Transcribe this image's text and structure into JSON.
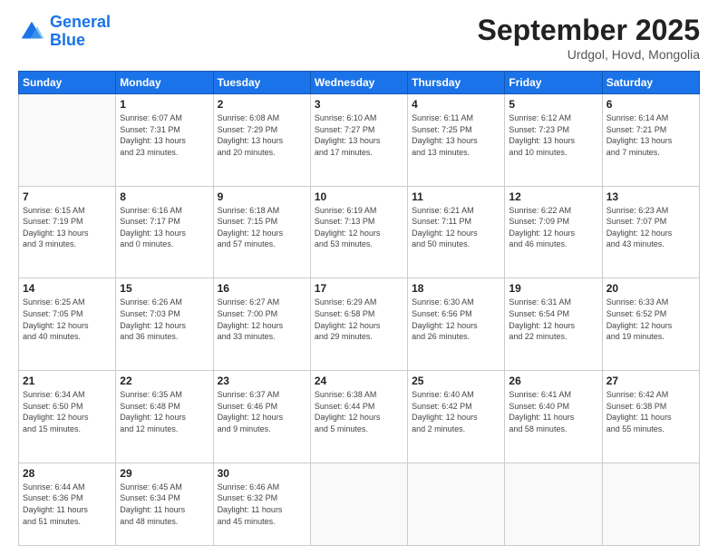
{
  "header": {
    "logo_line1": "General",
    "logo_line2": "Blue",
    "month": "September 2025",
    "location": "Urdgol, Hovd, Mongolia"
  },
  "weekdays": [
    "Sunday",
    "Monday",
    "Tuesday",
    "Wednesday",
    "Thursday",
    "Friday",
    "Saturday"
  ],
  "weeks": [
    [
      {
        "day": "",
        "info": ""
      },
      {
        "day": "1",
        "info": "Sunrise: 6:07 AM\nSunset: 7:31 PM\nDaylight: 13 hours\nand 23 minutes."
      },
      {
        "day": "2",
        "info": "Sunrise: 6:08 AM\nSunset: 7:29 PM\nDaylight: 13 hours\nand 20 minutes."
      },
      {
        "day": "3",
        "info": "Sunrise: 6:10 AM\nSunset: 7:27 PM\nDaylight: 13 hours\nand 17 minutes."
      },
      {
        "day": "4",
        "info": "Sunrise: 6:11 AM\nSunset: 7:25 PM\nDaylight: 13 hours\nand 13 minutes."
      },
      {
        "day": "5",
        "info": "Sunrise: 6:12 AM\nSunset: 7:23 PM\nDaylight: 13 hours\nand 10 minutes."
      },
      {
        "day": "6",
        "info": "Sunrise: 6:14 AM\nSunset: 7:21 PM\nDaylight: 13 hours\nand 7 minutes."
      }
    ],
    [
      {
        "day": "7",
        "info": "Sunrise: 6:15 AM\nSunset: 7:19 PM\nDaylight: 13 hours\nand 3 minutes."
      },
      {
        "day": "8",
        "info": "Sunrise: 6:16 AM\nSunset: 7:17 PM\nDaylight: 13 hours\nand 0 minutes."
      },
      {
        "day": "9",
        "info": "Sunrise: 6:18 AM\nSunset: 7:15 PM\nDaylight: 12 hours\nand 57 minutes."
      },
      {
        "day": "10",
        "info": "Sunrise: 6:19 AM\nSunset: 7:13 PM\nDaylight: 12 hours\nand 53 minutes."
      },
      {
        "day": "11",
        "info": "Sunrise: 6:21 AM\nSunset: 7:11 PM\nDaylight: 12 hours\nand 50 minutes."
      },
      {
        "day": "12",
        "info": "Sunrise: 6:22 AM\nSunset: 7:09 PM\nDaylight: 12 hours\nand 46 minutes."
      },
      {
        "day": "13",
        "info": "Sunrise: 6:23 AM\nSunset: 7:07 PM\nDaylight: 12 hours\nand 43 minutes."
      }
    ],
    [
      {
        "day": "14",
        "info": "Sunrise: 6:25 AM\nSunset: 7:05 PM\nDaylight: 12 hours\nand 40 minutes."
      },
      {
        "day": "15",
        "info": "Sunrise: 6:26 AM\nSunset: 7:03 PM\nDaylight: 12 hours\nand 36 minutes."
      },
      {
        "day": "16",
        "info": "Sunrise: 6:27 AM\nSunset: 7:00 PM\nDaylight: 12 hours\nand 33 minutes."
      },
      {
        "day": "17",
        "info": "Sunrise: 6:29 AM\nSunset: 6:58 PM\nDaylight: 12 hours\nand 29 minutes."
      },
      {
        "day": "18",
        "info": "Sunrise: 6:30 AM\nSunset: 6:56 PM\nDaylight: 12 hours\nand 26 minutes."
      },
      {
        "day": "19",
        "info": "Sunrise: 6:31 AM\nSunset: 6:54 PM\nDaylight: 12 hours\nand 22 minutes."
      },
      {
        "day": "20",
        "info": "Sunrise: 6:33 AM\nSunset: 6:52 PM\nDaylight: 12 hours\nand 19 minutes."
      }
    ],
    [
      {
        "day": "21",
        "info": "Sunrise: 6:34 AM\nSunset: 6:50 PM\nDaylight: 12 hours\nand 15 minutes."
      },
      {
        "day": "22",
        "info": "Sunrise: 6:35 AM\nSunset: 6:48 PM\nDaylight: 12 hours\nand 12 minutes."
      },
      {
        "day": "23",
        "info": "Sunrise: 6:37 AM\nSunset: 6:46 PM\nDaylight: 12 hours\nand 9 minutes."
      },
      {
        "day": "24",
        "info": "Sunrise: 6:38 AM\nSunset: 6:44 PM\nDaylight: 12 hours\nand 5 minutes."
      },
      {
        "day": "25",
        "info": "Sunrise: 6:40 AM\nSunset: 6:42 PM\nDaylight: 12 hours\nand 2 minutes."
      },
      {
        "day": "26",
        "info": "Sunrise: 6:41 AM\nSunset: 6:40 PM\nDaylight: 11 hours\nand 58 minutes."
      },
      {
        "day": "27",
        "info": "Sunrise: 6:42 AM\nSunset: 6:38 PM\nDaylight: 11 hours\nand 55 minutes."
      }
    ],
    [
      {
        "day": "28",
        "info": "Sunrise: 6:44 AM\nSunset: 6:36 PM\nDaylight: 11 hours\nand 51 minutes."
      },
      {
        "day": "29",
        "info": "Sunrise: 6:45 AM\nSunset: 6:34 PM\nDaylight: 11 hours\nand 48 minutes."
      },
      {
        "day": "30",
        "info": "Sunrise: 6:46 AM\nSunset: 6:32 PM\nDaylight: 11 hours\nand 45 minutes."
      },
      {
        "day": "",
        "info": ""
      },
      {
        "day": "",
        "info": ""
      },
      {
        "day": "",
        "info": ""
      },
      {
        "day": "",
        "info": ""
      }
    ]
  ]
}
